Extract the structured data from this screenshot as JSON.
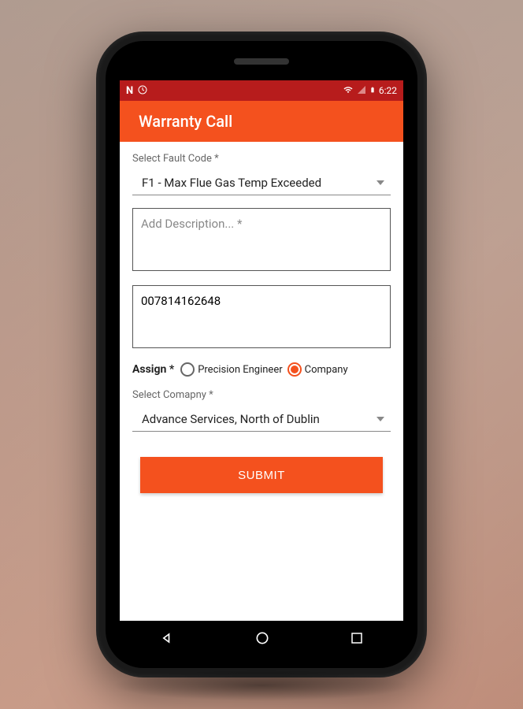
{
  "status_bar": {
    "time": "6:22"
  },
  "app_bar": {
    "title": "Warranty Call"
  },
  "form": {
    "fault_code": {
      "label": "Select Fault Code *",
      "value": "F1 - Max Flue Gas Temp Exceeded"
    },
    "description": {
      "placeholder": "Add Description... *",
      "value": ""
    },
    "phone": {
      "value": "007814162648"
    },
    "assign": {
      "label": "Assign *",
      "options": [
        {
          "label": "Precision Engineer",
          "checked": false
        },
        {
          "label": "Company",
          "checked": true
        }
      ]
    },
    "company": {
      "label": "Select Comapny *",
      "value": "Advance Services, North of Dublin"
    },
    "submit_label": "SUBMIT"
  }
}
